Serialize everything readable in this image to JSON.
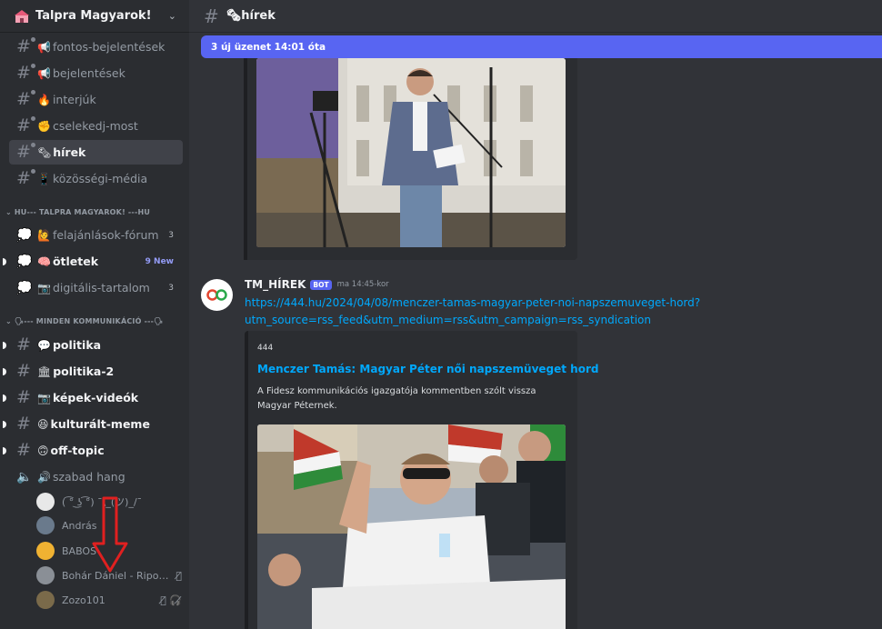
{
  "server": {
    "name": "Talpra Magyarok!"
  },
  "channels_top": [
    {
      "emoji": "📢",
      "label": "fontos-bejelentések",
      "unread": false,
      "active": false
    },
    {
      "emoji": "📢",
      "label": "bejelentések",
      "unread": false,
      "active": false
    },
    {
      "emoji": "🔥",
      "label": "interjúk",
      "unread": false,
      "active": false
    },
    {
      "emoji": "✊",
      "label": "cselekedj-most",
      "unread": false,
      "active": false
    },
    {
      "emoji": "🗞",
      "label": "hírek",
      "unread": false,
      "active": true
    },
    {
      "emoji": "📱",
      "label": "közösségi-média",
      "unread": false,
      "active": false
    }
  ],
  "category1": {
    "label": "HU--- TALPRA MAGYAROK! ---HU"
  },
  "forums": [
    {
      "emoji": "🙋",
      "label": "felajánlások-fórum",
      "count": "3",
      "count_new": false,
      "unread": false
    },
    {
      "emoji": "🧠",
      "label": "ötletek",
      "count": "9 New",
      "count_new": true,
      "unread": true
    },
    {
      "emoji": "📷",
      "label": "digitális-tartalom",
      "count": "3",
      "count_new": false,
      "unread": false
    }
  ],
  "category2": {
    "label": "🗣--- MINDEN KOMMUNIKÁCIÓ ---🗣"
  },
  "channels_bottom": [
    {
      "emoji": "💬",
      "label": "politika",
      "unread": true
    },
    {
      "emoji": "🏛",
      "label": "politika-2",
      "unread": true
    },
    {
      "emoji": "📷",
      "label": "képek-videók",
      "unread": true
    },
    {
      "emoji": "😆",
      "label": "kulturált-meme",
      "unread": true
    },
    {
      "emoji": "🙃",
      "label": "off-topic",
      "unread": true
    }
  ],
  "voice_channel": {
    "emoji": "🔊",
    "label": "szabad hang"
  },
  "voice_users": [
    {
      "name": "( ͡° ͜ʖ ͡°) ¯\\_(ツ)_/¯",
      "avatar_color": "#e8e8e8",
      "icons": ""
    },
    {
      "name": "András",
      "avatar_color": "#6a7a8c",
      "icons": ""
    },
    {
      "name": "BABOS",
      "avatar_color": "#f0b232",
      "icons": ""
    },
    {
      "name": "Bohár Dániel - Riporter",
      "avatar_color": "#8a8f96",
      "icons": "🎙̸"
    },
    {
      "name": "Zozo101",
      "avatar_color": "#7a6a4a",
      "icons": "🎙̸ 🎧̸"
    }
  ],
  "topbar": {
    "channel": "🗞hírek"
  },
  "new_messages_bar": {
    "text": "3 új üzenet 14:01 óta"
  },
  "message": {
    "author": "TM_HÍREK",
    "bot_badge": "BOT",
    "timestamp": "ma 14:45-kor",
    "link": "https://444.hu/2024/04/08/menczer-tamas-magyar-peter-noi-napszemuveget-hord?utm_source=rss_feed&utm_medium=rss&utm_campaign=rss_syndication",
    "embed": {
      "provider": "444",
      "title": "Menczer Tamás: Magyar Péter női napszemüveget hord",
      "description": "A Fidesz kommunikációs igazgatója kommentben szólt vissza Magyar Péternek."
    }
  },
  "colors": {
    "accent": "#5865f2",
    "link": "#00a8fc",
    "arrow": "#e02020"
  }
}
